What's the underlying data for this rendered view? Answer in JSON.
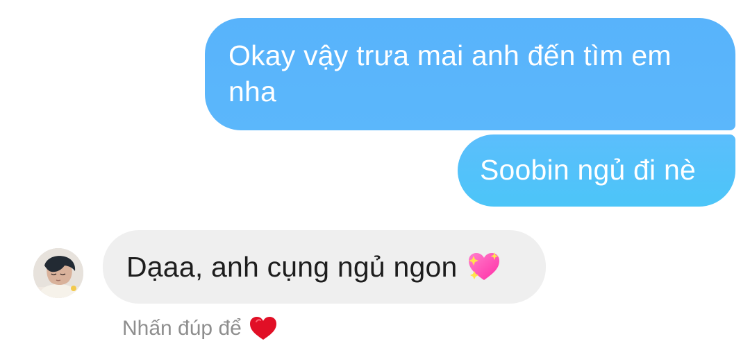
{
  "messages": [
    {
      "text": "Okay vậy trưa mai anh đến tìm em nha"
    },
    {
      "text": "Soobin ngủ đi nè"
    },
    {
      "text": "Dạaa, anh cụng ngủ ngon"
    }
  ],
  "hint": {
    "text": "Nhấn đúp để"
  },
  "icons": {
    "sparkle_heart": "sparkling-heart",
    "reaction_heart": "red-heart"
  },
  "colors": {
    "outgoing_bubble": "#58B3FB",
    "outgoing_bubble_2": "#4CC5F8",
    "incoming_bubble": "#EFEFEF",
    "text_dark": "#1D1D1D",
    "text_light": "#FFFFFF",
    "hint_text": "#8E8E8E"
  }
}
